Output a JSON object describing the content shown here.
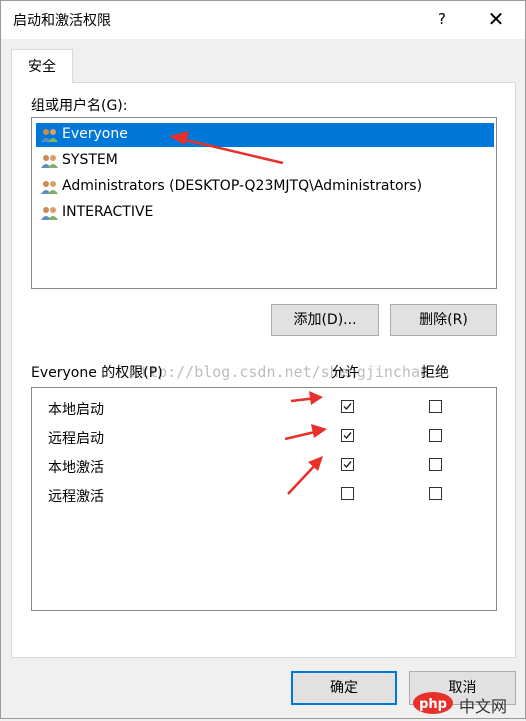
{
  "window": {
    "title": "启动和激活权限",
    "help": "?",
    "close": "✕"
  },
  "tabs": [
    {
      "label": "安全"
    }
  ],
  "group_label": "组或用户名(G):",
  "users": [
    {
      "name": "Everyone",
      "selected": true
    },
    {
      "name": "SYSTEM"
    },
    {
      "name": "Administrators (DESKTOP-Q23MJTQ\\Administrators)"
    },
    {
      "name": "INTERACTIVE"
    }
  ],
  "buttons": {
    "add": "添加(D)...",
    "remove": "删除(R)",
    "ok": "确定",
    "cancel": "取消"
  },
  "permissions": {
    "header": "Everyone 的权限(P)",
    "allow_header": "允许",
    "deny_header": "拒绝",
    "items": [
      {
        "name": "本地启动",
        "allow": true,
        "deny": false
      },
      {
        "name": "远程启动",
        "allow": true,
        "deny": false
      },
      {
        "name": "本地激活",
        "allow": true,
        "deny": false
      },
      {
        "name": "远程激活",
        "allow": false,
        "deny": false
      }
    ]
  },
  "watermark": "http://blog.csdn.net/shengjinchao",
  "logo_text": "中文网",
  "colors": {
    "selection": "#0078d7",
    "arrow": "#e8302a",
    "default_button_border": "#0078d7"
  },
  "icons": {
    "user": "user-group-icon",
    "check": "checkmark-icon"
  }
}
